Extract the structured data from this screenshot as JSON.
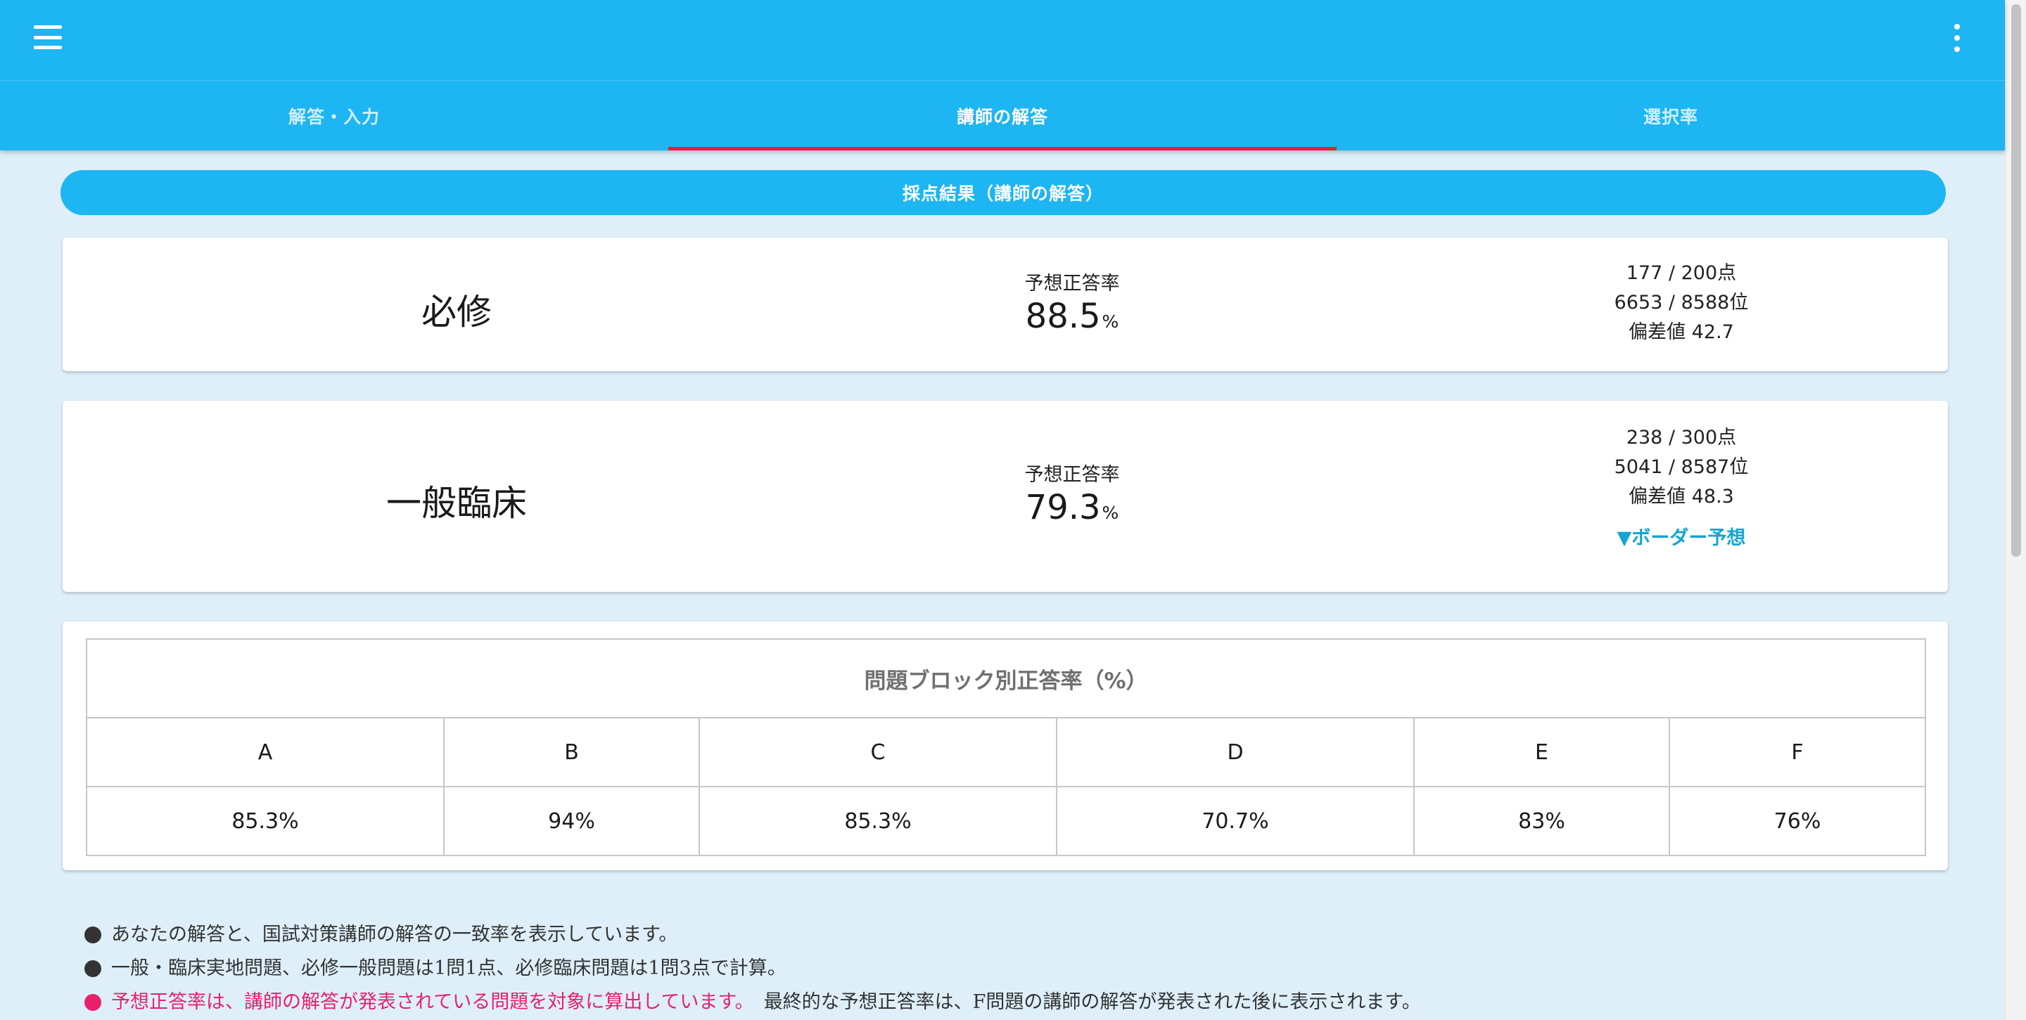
{
  "appbar": {
    "menu_icon": "hamburger-menu-icon",
    "more_icon": "more-vertical-icon",
    "bg_color": "#1eb5f3",
    "indicator_color": "#e8202e"
  },
  "tabs": [
    {
      "label": "解答・入力",
      "active": false
    },
    {
      "label": "講師の解答",
      "active": true
    },
    {
      "label": "選択率",
      "active": false
    }
  ],
  "section_title": "採点結果（講師の解答）",
  "results": [
    {
      "subject": "必修",
      "rate_label": "予想正答率",
      "rate_value": "88.5",
      "rate_unit": "%",
      "score": "177 / 200点",
      "rank": "6653 / 8588位",
      "deviation": "偏差値 42.7"
    },
    {
      "subject": "一般臨床",
      "rate_label": "予想正答率",
      "rate_value": "79.3",
      "rate_unit": "%",
      "score": "238 / 300点",
      "rank": "5041 / 8587位",
      "deviation": "偏差値 48.3",
      "border_link": "▼ボーダー予想"
    }
  ],
  "block_table": {
    "title": "問題ブロック別正答率（%）",
    "columns": [
      "A",
      "B",
      "C",
      "D",
      "E",
      "F"
    ],
    "values": [
      "85.3%",
      "94%",
      "85.3%",
      "70.7%",
      "83%",
      "76%"
    ]
  },
  "notes": [
    {
      "text": "あなたの解答と、国試対策講師の解答の一致率を表示しています。"
    },
    {
      "text": "一般・臨床実地問題、必修一般問題は1問1点、必修臨床問題は1問3点で計算。"
    },
    {
      "highlight": "予想正答率は、講師の解答が発表されている問題を対象に算出しています。",
      "text": "最終的な予想正答率は、F問題の講師の解答が発表された後に表示されます。",
      "highlight_color": "#e8206c"
    }
  ]
}
